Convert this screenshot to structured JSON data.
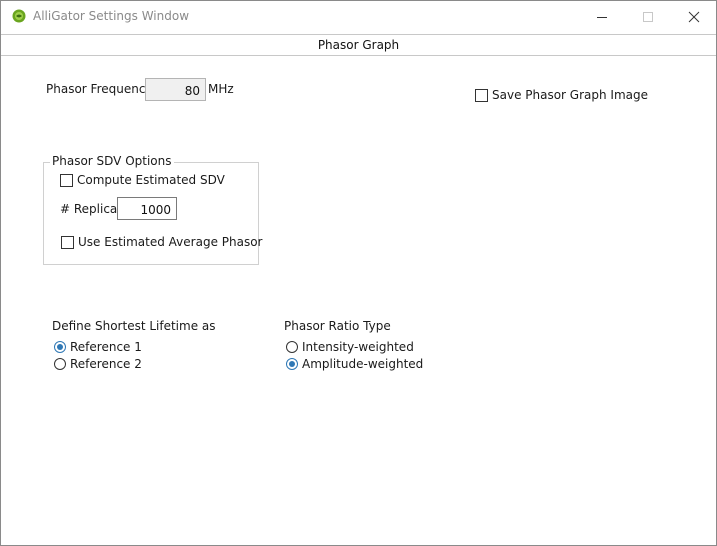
{
  "window": {
    "title": "AlliGator Settings Window"
  },
  "tab": {
    "label": "Phasor Graph"
  },
  "frequency": {
    "label": "Phasor Frequency",
    "value": "80",
    "unit": "MHz"
  },
  "save_image": {
    "label": "Save Phasor Graph Image",
    "checked": false
  },
  "sdv_options": {
    "title": "Phasor SDV Options",
    "compute_label": "Compute Estimated SDV",
    "compute_checked": false,
    "replicas_label": "# Replicas",
    "replicas_value": "1000",
    "avg_label": "Use Estimated Average Phasor",
    "avg_checked": false
  },
  "shortest_lifetime": {
    "title": "Define Shortest Lifetime as",
    "options": [
      "Reference 1",
      "Reference 2"
    ],
    "selected": "Reference 1"
  },
  "ratio_type": {
    "title": "Phasor Ratio Type",
    "options": [
      "Intensity-weighted",
      "Amplitude-weighted"
    ],
    "selected": "Amplitude-weighted"
  },
  "colors": {
    "app_icon": "#6aa51f",
    "radio_accent": "#2f78b5",
    "title_text": "#8a8a8a"
  }
}
